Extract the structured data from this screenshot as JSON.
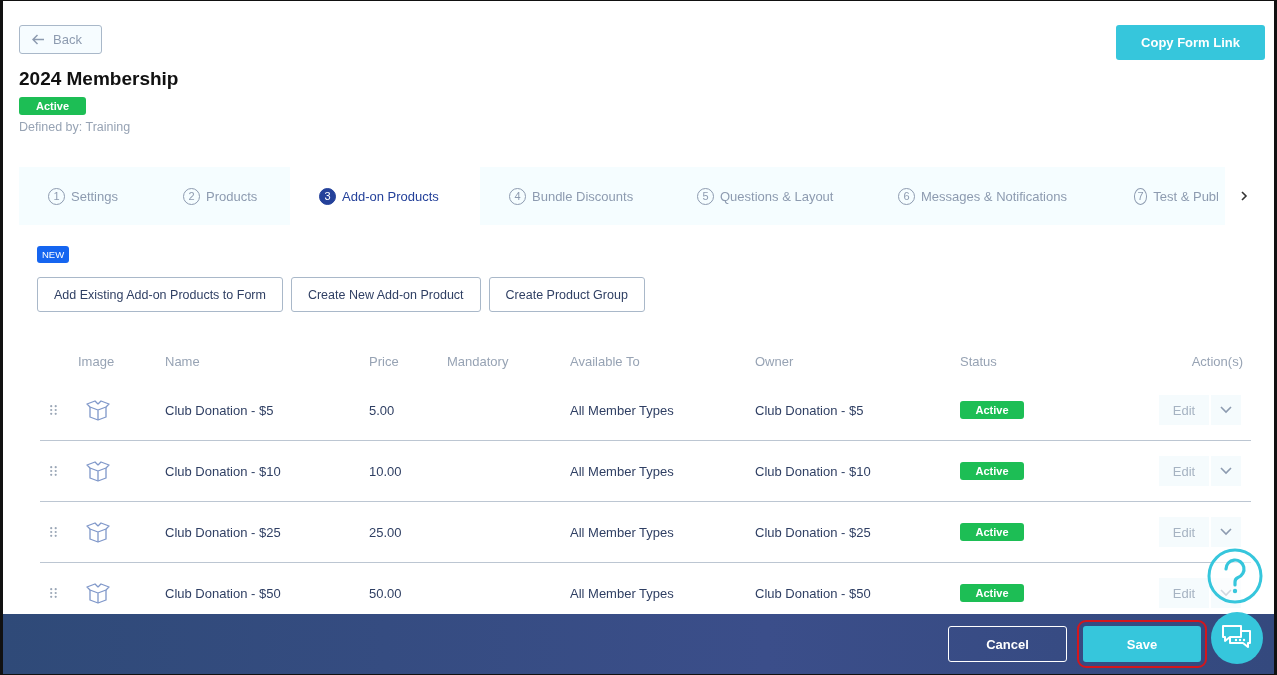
{
  "header": {
    "back_button": "Back",
    "title": "2024 Membership",
    "status": "Active",
    "defined_by": "Defined by: Training",
    "copy_link_button": "Copy Form Link"
  },
  "tabs": [
    {
      "number": "1",
      "label": "Settings",
      "selected": false
    },
    {
      "number": "2",
      "label": "Products",
      "selected": false
    },
    {
      "number": "3",
      "label": "Add-on Products",
      "selected": true
    },
    {
      "number": "4",
      "label": "Bundle Discounts",
      "selected": false
    },
    {
      "number": "5",
      "label": "Questions & Layout",
      "selected": false
    },
    {
      "number": "6",
      "label": "Messages & Notifications",
      "selected": false
    },
    {
      "number": "7",
      "label": "Test & Publ",
      "selected": false
    }
  ],
  "new_badge": "NEW",
  "action_buttons": [
    "Add Existing Add-on Products to Form",
    "Create New Add-on Product",
    "Create Product Group"
  ],
  "table": {
    "columns": [
      "Image",
      "Name",
      "Price",
      "Mandatory",
      "Available To",
      "Owner",
      "Status",
      "Action(s)"
    ],
    "rows": [
      {
        "name": "Club Donation - $5",
        "price": "5.00",
        "available_to": "All Member Types",
        "owner": "Club Donation - $5",
        "status": "Active",
        "edit": "Edit"
      },
      {
        "name": "Club Donation - $10",
        "price": "10.00",
        "available_to": "All Member Types",
        "owner": "Club Donation - $10",
        "status": "Active",
        "edit": "Edit"
      },
      {
        "name": "Club Donation - $25",
        "price": "25.00",
        "available_to": "All Member Types",
        "owner": "Club Donation - $25",
        "status": "Active",
        "edit": "Edit"
      },
      {
        "name": "Club Donation - $50",
        "price": "50.00",
        "available_to": "All Member Types",
        "owner": "Club Donation - $50",
        "status": "Active",
        "edit": "Edit"
      }
    ]
  },
  "footer": {
    "cancel": "Cancel",
    "save": "Save"
  }
}
